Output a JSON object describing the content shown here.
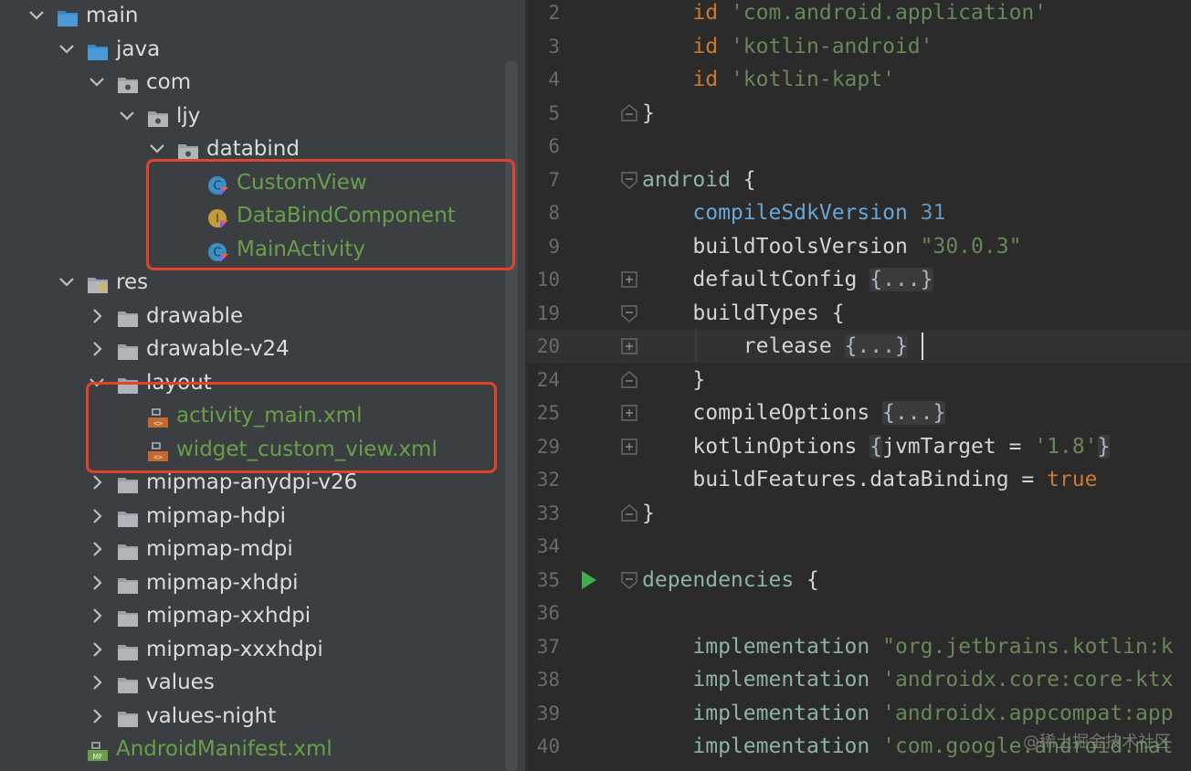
{
  "tree": {
    "rows": [
      {
        "label": "main",
        "indent": 0,
        "chevron": "down",
        "icon": "folder-blue"
      },
      {
        "label": "java",
        "indent": 1,
        "chevron": "down",
        "icon": "folder-blue"
      },
      {
        "label": "com",
        "indent": 2,
        "chevron": "down",
        "icon": "package"
      },
      {
        "label": "ljy",
        "indent": 3,
        "chevron": "down",
        "icon": "package"
      },
      {
        "label": "databind",
        "indent": 4,
        "chevron": "down",
        "icon": "package"
      },
      {
        "label": "CustomView",
        "indent": 5,
        "chevron": "none",
        "icon": "kotlin-class",
        "color": "green"
      },
      {
        "label": "DataBindComponent",
        "indent": 5,
        "chevron": "none",
        "icon": "kotlin-interface",
        "color": "green"
      },
      {
        "label": "MainActivity",
        "indent": 5,
        "chevron": "none",
        "icon": "kotlin-class",
        "color": "green"
      },
      {
        "label": "res",
        "indent": 1,
        "chevron": "down",
        "icon": "folder-res"
      },
      {
        "label": "drawable",
        "indent": 2,
        "chevron": "right",
        "icon": "folder"
      },
      {
        "label": "drawable-v24",
        "indent": 2,
        "chevron": "right",
        "icon": "folder"
      },
      {
        "label": "layout",
        "indent": 2,
        "chevron": "down",
        "icon": "folder"
      },
      {
        "label": "activity_main.xml",
        "indent": 3,
        "chevron": "none",
        "icon": "xml-file",
        "color": "green"
      },
      {
        "label": "widget_custom_view.xml",
        "indent": 3,
        "chevron": "none",
        "icon": "xml-file",
        "color": "green"
      },
      {
        "label": "mipmap-anydpi-v26",
        "indent": 2,
        "chevron": "right",
        "icon": "folder"
      },
      {
        "label": "mipmap-hdpi",
        "indent": 2,
        "chevron": "right",
        "icon": "folder"
      },
      {
        "label": "mipmap-mdpi",
        "indent": 2,
        "chevron": "right",
        "icon": "folder"
      },
      {
        "label": "mipmap-xhdpi",
        "indent": 2,
        "chevron": "right",
        "icon": "folder"
      },
      {
        "label": "mipmap-xxhdpi",
        "indent": 2,
        "chevron": "right",
        "icon": "folder"
      },
      {
        "label": "mipmap-xxxhdpi",
        "indent": 2,
        "chevron": "right",
        "icon": "folder"
      },
      {
        "label": "values",
        "indent": 2,
        "chevron": "right",
        "icon": "folder"
      },
      {
        "label": "values-night",
        "indent": 2,
        "chevron": "right",
        "icon": "folder"
      },
      {
        "label": "AndroidManifest.xml",
        "indent": 1,
        "chevron": "none",
        "icon": "manifest-file",
        "color": "green"
      }
    ]
  },
  "editor": {
    "lines": [
      {
        "num": "2",
        "tokens": [
          {
            "t": "    id ",
            "c": "kw"
          },
          {
            "t": "'com.android.application'",
            "c": "str"
          }
        ]
      },
      {
        "num": "3",
        "tokens": [
          {
            "t": "    id ",
            "c": "kw"
          },
          {
            "t": "'kotlin-android'",
            "c": "str"
          }
        ]
      },
      {
        "num": "4",
        "tokens": [
          {
            "t": "    id ",
            "c": "kw"
          },
          {
            "t": "'kotlin-kapt'",
            "c": "str"
          }
        ]
      },
      {
        "num": "5",
        "gutter": "fold-end",
        "tokens": [
          {
            "t": "}",
            "c": ""
          }
        ]
      },
      {
        "num": "6",
        "tokens": []
      },
      {
        "num": "7",
        "gutter": "fold-start",
        "tokens": [
          {
            "t": "android ",
            "c": "fn"
          },
          {
            "t": "{",
            "c": ""
          }
        ]
      },
      {
        "num": "8",
        "tokens": [
          {
            "t": "    ",
            "c": ""
          },
          {
            "t": "compileSdkVersion",
            "c": "prop"
          },
          {
            "t": " ",
            "c": ""
          },
          {
            "t": "31",
            "c": "num"
          }
        ]
      },
      {
        "num": "9",
        "tokens": [
          {
            "t": "    buildToolsVersion ",
            "c": ""
          },
          {
            "t": "\"30.0.3\"",
            "c": "str"
          }
        ]
      },
      {
        "num": "10",
        "gutter": "fold-plus",
        "tokens": [
          {
            "t": "    defaultConfig ",
            "c": ""
          },
          {
            "t": "{...}",
            "c": "fold"
          }
        ]
      },
      {
        "num": "19",
        "gutter": "fold-start",
        "tokens": [
          {
            "t": "    buildTypes {",
            "c": ""
          }
        ]
      },
      {
        "num": "20",
        "gutter": "fold-plus",
        "current": true,
        "tokens": [
          {
            "t": "        release ",
            "c": ""
          },
          {
            "t": "{...}",
            "c": "fold"
          }
        ]
      },
      {
        "num": "24",
        "gutter": "fold-end",
        "tokens": [
          {
            "t": "    }",
            "c": ""
          }
        ]
      },
      {
        "num": "25",
        "gutter": "fold-plus",
        "tokens": [
          {
            "t": "    compileOptions ",
            "c": ""
          },
          {
            "t": "{...}",
            "c": "fold"
          }
        ]
      },
      {
        "num": "29",
        "gutter": "fold-plus",
        "tokens": [
          {
            "t": "    kotlinOptions ",
            "c": ""
          },
          {
            "t": "{",
            "c": "fold"
          },
          {
            "t": "jvmTarget = ",
            "c": ""
          },
          {
            "t": "'1.8'",
            "c": "str"
          },
          {
            "t": "}",
            "c": "fold"
          }
        ]
      },
      {
        "num": "32",
        "tokens": [
          {
            "t": "    buildFeatures.dataBinding = ",
            "c": ""
          },
          {
            "t": "true",
            "c": "kw"
          }
        ]
      },
      {
        "num": "33",
        "gutter": "fold-end",
        "tokens": [
          {
            "t": "}",
            "c": ""
          }
        ]
      },
      {
        "num": "34",
        "tokens": []
      },
      {
        "num": "35",
        "gutter": "fold-start",
        "run": true,
        "tokens": [
          {
            "t": "dependencies ",
            "c": "fn"
          },
          {
            "t": "{",
            "c": ""
          }
        ]
      },
      {
        "num": "36",
        "tokens": []
      },
      {
        "num": "37",
        "tokens": [
          {
            "t": "    implementation ",
            "c": "fn"
          },
          {
            "t": "\"org.jetbrains.kotlin:k",
            "c": "str"
          }
        ]
      },
      {
        "num": "38",
        "tokens": [
          {
            "t": "    implementation ",
            "c": "fn"
          },
          {
            "t": "'androidx.core:core-ktx",
            "c": "str"
          }
        ]
      },
      {
        "num": "39",
        "tokens": [
          {
            "t": "    implementation ",
            "c": "fn"
          },
          {
            "t": "'androidx.appcompat:app",
            "c": "str"
          }
        ]
      },
      {
        "num": "40",
        "tokens": [
          {
            "t": "    implementation ",
            "c": "fn"
          },
          {
            "t": "'com.google.android.mat",
            "c": "str"
          }
        ]
      }
    ]
  },
  "watermark": "@稀土掘金技术社区",
  "colors": {
    "highlight_border": "#e0442f",
    "tree_bg": "#3c3f41",
    "editor_bg": "#2b2b2b"
  }
}
